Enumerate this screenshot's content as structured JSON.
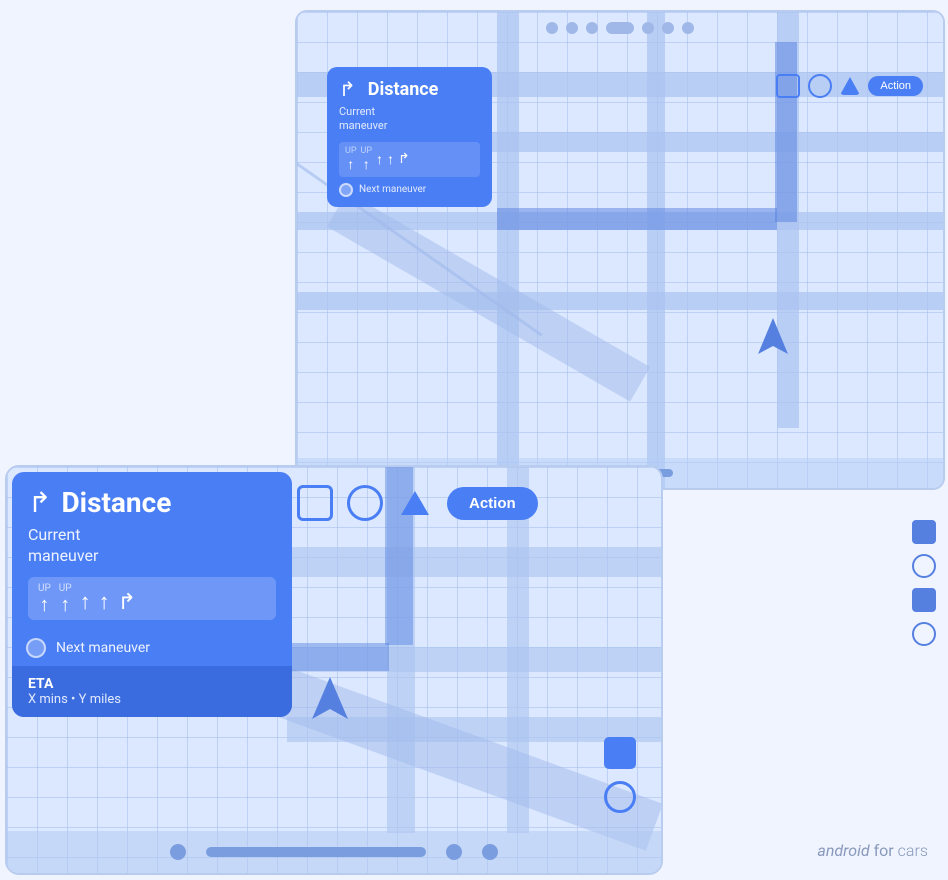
{
  "small_screen": {
    "nav_card": {
      "turn_icon": "↱",
      "distance_title": "Distance",
      "maneuver_label": "Current\nmaneuver",
      "lanes": [
        {
          "label": "UP",
          "arrow": "↑"
        },
        {
          "label": "UP",
          "arrow": "↑"
        },
        {
          "label": "",
          "arrow": "↑"
        },
        {
          "label": "",
          "arrow": "↑"
        },
        {
          "label": "",
          "arrow": "↱"
        }
      ],
      "next_maneuver_label": "Next maneuver"
    },
    "action_bar": {
      "action_label": "Action",
      "icons": [
        "square",
        "circle",
        "triangle"
      ]
    },
    "top_dots_count": 7
  },
  "large_screen": {
    "nav_card": {
      "turn_icon": "↱",
      "distance_title": "Distance",
      "maneuver_label": "Current\nmaneuver",
      "lanes": [
        {
          "label": "UP",
          "arrow": "↑"
        },
        {
          "label": "UP",
          "arrow": "↑"
        },
        {
          "label": "",
          "arrow": "↑"
        },
        {
          "label": "",
          "arrow": "↑"
        },
        {
          "label": "",
          "arrow": "↱"
        }
      ],
      "next_maneuver_label": "Next maneuver",
      "eta_title": "ETA",
      "eta_details": "X mins • Y miles"
    },
    "action_bar": {
      "action_label": "Action",
      "icons": [
        "square",
        "circle",
        "triangle"
      ]
    }
  },
  "watermark": {
    "android_part": "android",
    "for_part": " for ",
    "cars_part": "cars"
  },
  "colors": {
    "primary_blue": "#4a7ef5",
    "light_blue_bg": "#dce8ff",
    "map_road": "#a0b8e8",
    "accent_blue": "#5580e0"
  }
}
